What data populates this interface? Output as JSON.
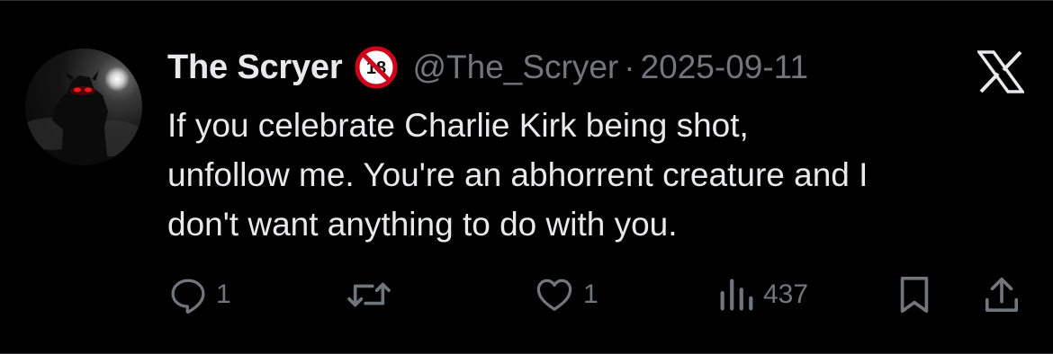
{
  "tweet": {
    "display_name": "The Scryer",
    "handle": "@The_Scryer",
    "separator": "·",
    "date": "2025-09-11",
    "text_lines": [
      "If you celebrate Charlie Kirk being shot,",
      "unfollow me. You're an abhorrent creature and I",
      "don't want anything to do with you."
    ],
    "badge_text": "18"
  },
  "actions": {
    "reply_count": "1",
    "repost_count": "",
    "like_count": "1",
    "views_count": "437"
  },
  "icons": {
    "badge": "no-one-under-eighteen-icon",
    "logo": "x-logo-icon",
    "reply": "reply-icon",
    "repost": "repost-icon",
    "like": "like-icon",
    "views": "views-icon",
    "bookmark": "bookmark-icon",
    "share": "share-icon"
  },
  "colors": {
    "background": "#000000",
    "text_primary": "#e7e9ea",
    "text_secondary": "#71767b",
    "badge_red": "#d0021b",
    "divider": "#2f3336"
  }
}
